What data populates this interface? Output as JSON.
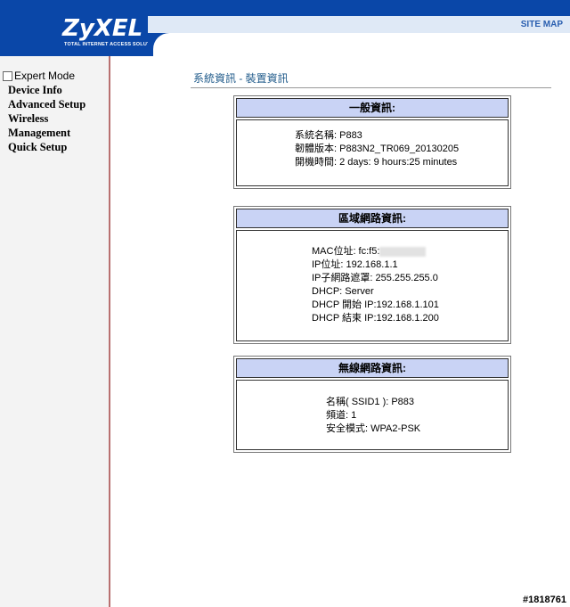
{
  "brand": {
    "logo": "ZyXEL",
    "tagline": "TOTAL INTERNET ACCESS SOLUTION",
    "site_map": "SITE MAP",
    "colors": {
      "header": "#0a47a8",
      "panel_head": "#c9d3f5",
      "sidebar_border": "#b87070"
    }
  },
  "sidebar": {
    "expert_mode": "Expert Mode",
    "items": [
      {
        "label": "Device Info"
      },
      {
        "label": "Advanced Setup"
      },
      {
        "label": "Wireless"
      },
      {
        "label": "Management"
      },
      {
        "label": "Quick Setup"
      }
    ]
  },
  "main": {
    "breadcrumb": "系統資訊 - 裝置資訊",
    "general": {
      "title": "一般資訊:",
      "rows": [
        "系統名稱: P883",
        "韌體版本: P883N2_TR069_20130205",
        "開機時間: 2 days: 9 hours:25 minutes"
      ]
    },
    "lan": {
      "title": "區域網路資訊:",
      "mac": "MAC位址: fc:f5:",
      "rows": [
        "IP位址: 192.168.1.1",
        "IP子網路遮罩: 255.255.255.0",
        "DHCP: Server",
        "DHCP 開始 IP:192.168.1.101",
        "DHCP 結束 IP:192.168.1.200"
      ]
    },
    "wireless": {
      "title": "無線網路資訊:",
      "rows": [
        "名稱( SSID1 ): P883",
        "頻道: 1",
        "安全模式: WPA2-PSK"
      ]
    }
  },
  "watermark": "#1818761"
}
